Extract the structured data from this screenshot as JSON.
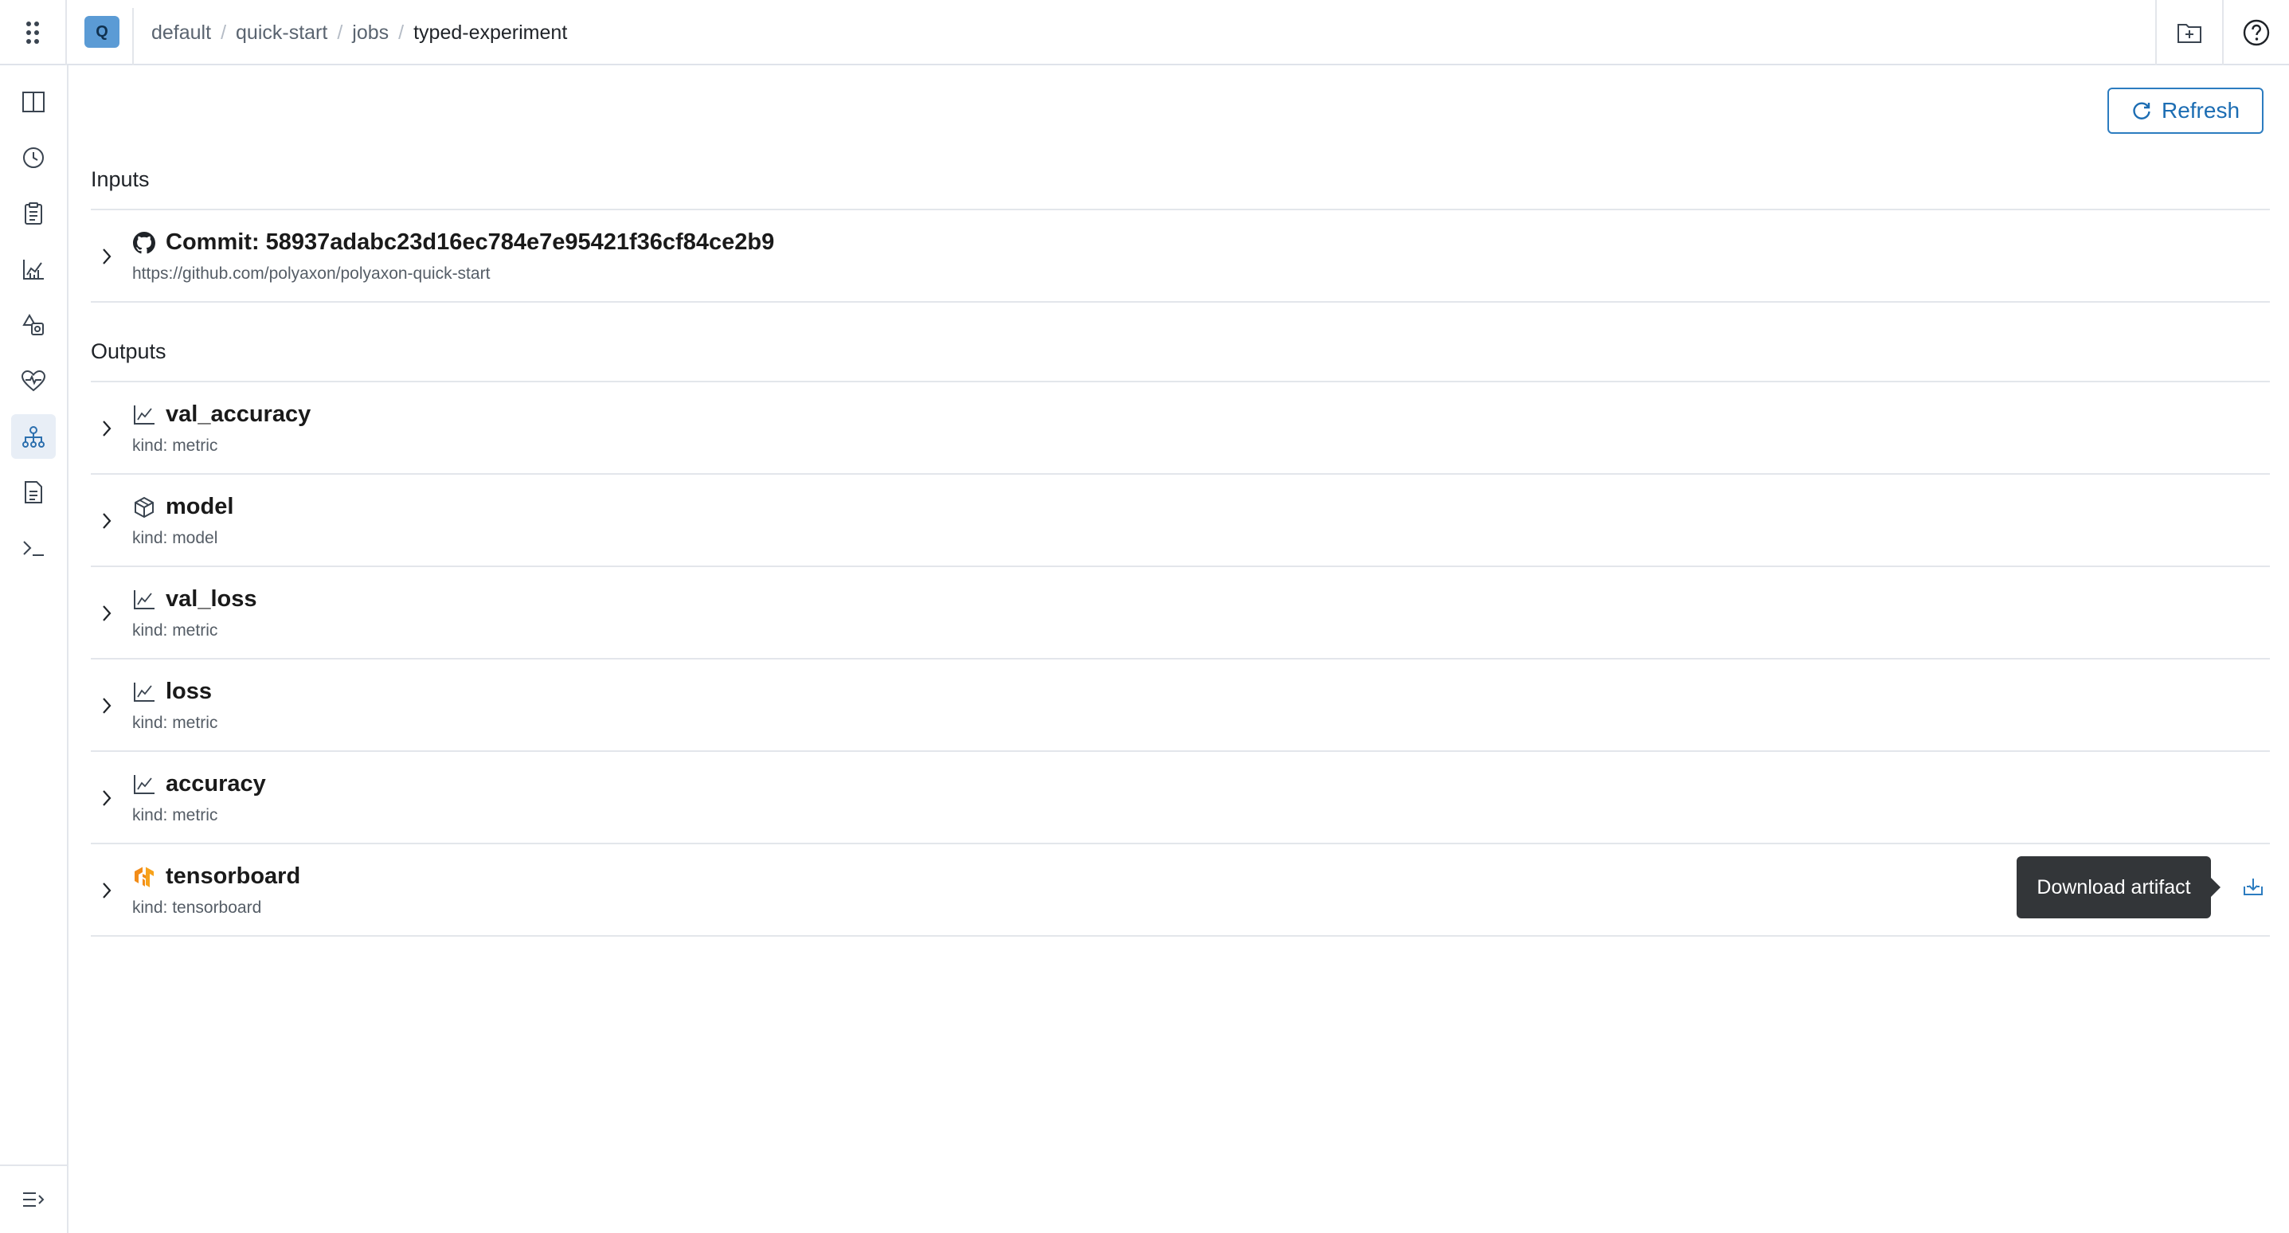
{
  "header": {
    "project_badge": "Q",
    "breadcrumb": [
      "default",
      "quick-start",
      "jobs"
    ],
    "current": "typed-experiment"
  },
  "toolbar": {
    "refresh_label": "Refresh"
  },
  "inputs": {
    "title": "Inputs",
    "items": [
      {
        "name": "Commit: 58937adabc23d16ec784e7e95421f36cf84ce2b9",
        "sub": "https://github.com/polyaxon/polyaxon-quick-start",
        "icon": "github-icon"
      }
    ]
  },
  "outputs": {
    "title": "Outputs",
    "items": [
      {
        "name": "val_accuracy",
        "sub": "kind: metric",
        "icon": "metric-chart-icon"
      },
      {
        "name": "model",
        "sub": "kind: model",
        "icon": "model-cube-icon"
      },
      {
        "name": "val_loss",
        "sub": "kind: metric",
        "icon": "metric-chart-icon"
      },
      {
        "name": "loss",
        "sub": "kind: metric",
        "icon": "metric-chart-icon"
      },
      {
        "name": "accuracy",
        "sub": "kind: metric",
        "icon": "metric-chart-icon"
      },
      {
        "name": "tensorboard",
        "sub": "kind: tensorboard",
        "icon": "tensorflow-icon"
      }
    ]
  },
  "tooltip": {
    "text": "Download artifact"
  },
  "colors": {
    "accent": "#2c7cc0",
    "tensorflow": "#f28c18",
    "tooltip_bg": "#333639"
  }
}
